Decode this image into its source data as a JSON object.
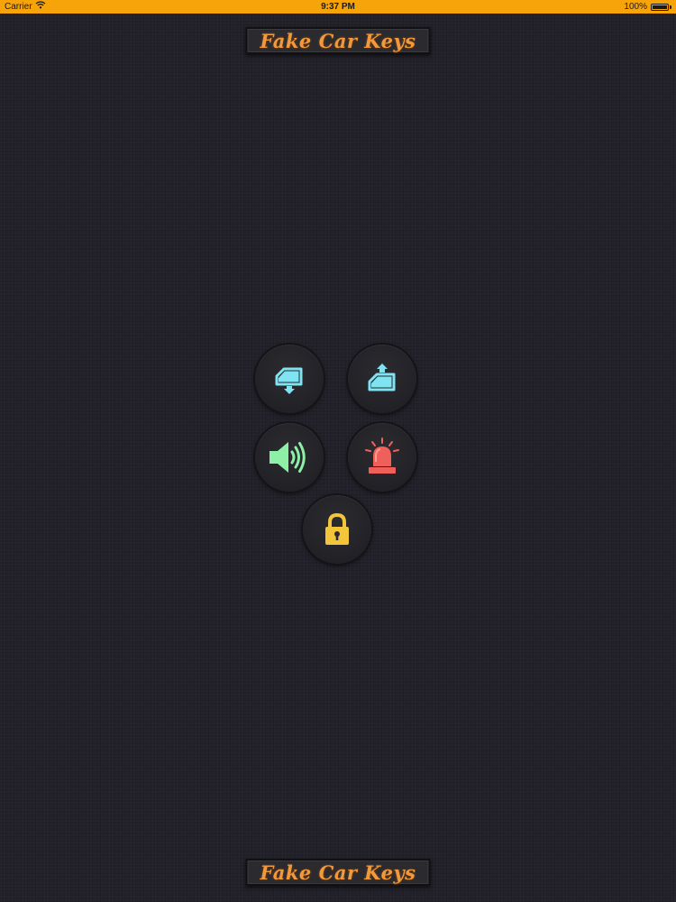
{
  "status_bar": {
    "carrier": "Carrier",
    "time": "9:37 PM",
    "battery": "100%",
    "battery_level": 1.0,
    "wifi_icon": "wifi-icon",
    "battery_icon": "battery-icon"
  },
  "header": {
    "title": "Fake Car Keys"
  },
  "footer": {
    "title": "Fake Car Keys"
  },
  "buttons": [
    {
      "name": "window-down-button",
      "icon": "window-down-icon",
      "color": "#7fe3f2"
    },
    {
      "name": "window-up-button",
      "icon": "window-up-icon",
      "color": "#7fe3f2"
    },
    {
      "name": "horn-button",
      "icon": "speaker-icon",
      "color": "#8ef0a6"
    },
    {
      "name": "alarm-button",
      "icon": "siren-icon",
      "color": "#f0605a"
    },
    {
      "name": "lock-button",
      "icon": "padlock-icon",
      "color": "#f2c53a"
    }
  ],
  "colors": {
    "status_bar": "#f7a30a",
    "background": "#222129",
    "title_text": "#f29a3b"
  }
}
